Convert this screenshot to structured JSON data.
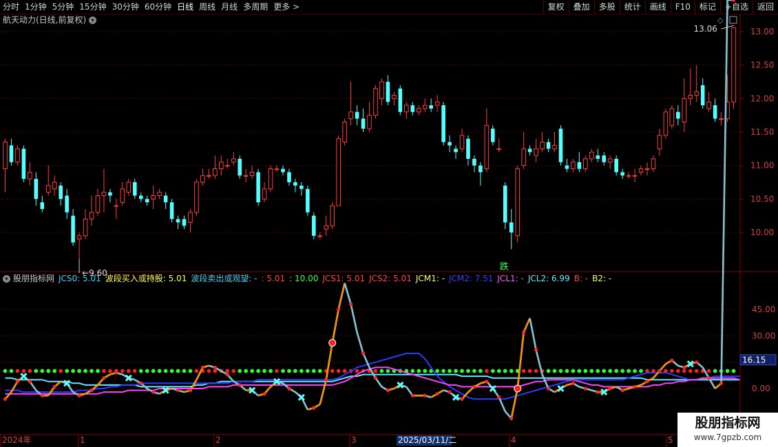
{
  "toolbar": {
    "periods": [
      "分时",
      "1分钟",
      "5分钟",
      "15分钟",
      "30分钟",
      "60分钟",
      "日线",
      "周线",
      "月线",
      "多周期",
      "更多 >"
    ],
    "active_period": "日线",
    "right_buttons": [
      "复权",
      "叠加",
      "多股",
      "统计",
      "画线",
      "F10",
      "标记",
      "+自选",
      "返回"
    ]
  },
  "main_chart": {
    "title": "航天动力(日线,前复权)",
    "price_labels": [
      "13.00",
      "12.50",
      "12.00",
      "11.50",
      "11.00",
      "10.50",
      "10.00"
    ],
    "high_marker": "13.06",
    "low_marker": "9.60",
    "signal_text": "跌"
  },
  "indicator": {
    "name": "股朋指标网",
    "header_items": [
      {
        "text": "JCS0: 5.01",
        "color": "#46d2f0"
      },
      {
        "text": "波段买入或持股: 5.01",
        "color": "#ffff55"
      },
      {
        "text": "波段卖出或观望: -",
        "color": "#46d2f0"
      },
      {
        "text": ": 5.01",
        "color": "#ff4040"
      },
      {
        "text": ": 10.00",
        "color": "#40ff40"
      },
      {
        "text": "JCS1: 5.01",
        "color": "#ff4040"
      },
      {
        "text": "JCS2: 5.01",
        "color": "#ff4040"
      },
      {
        "text": "JCM1: -",
        "color": "#ffff55"
      },
      {
        "text": "JCM2: 7.51",
        "color": "#3c3cff"
      },
      {
        "text": "JCL1: -",
        "color": "#ff55ff"
      },
      {
        "text": "JCL2: 6.99",
        "color": "#66e8ff"
      },
      {
        "text": "B: -",
        "color": "#ff4040"
      },
      {
        "text": "B2: -",
        "color": "#ffff55"
      }
    ],
    "axis_labels": [
      "45.00",
      "30.00",
      "15.00",
      "0.00"
    ],
    "current_value": "16.15"
  },
  "time_axis": {
    "labels": [
      "2024年",
      "1",
      "2",
      "3",
      "4",
      "5"
    ],
    "cursor_date": "2025/03/11/二"
  },
  "watermark": {
    "title": "股朋指标网",
    "url": "www.7gpzb.com"
  },
  "chart_data": {
    "type": "candlestick",
    "title": "航天动力(日线,前复权)",
    "ylim": [
      9.4,
      13.2
    ],
    "candles": [
      [
        10.95,
        11.35,
        10.6,
        11.4
      ],
      [
        11.3,
        11.05,
        11.0,
        11.4
      ],
      [
        11.05,
        11.25,
        11.0,
        11.3
      ],
      [
        11.25,
        10.8,
        10.75,
        11.3
      ],
      [
        10.8,
        10.9,
        10.7,
        11.05
      ],
      [
        10.8,
        10.5,
        10.4,
        10.9
      ],
      [
        10.45,
        10.35,
        10.3,
        10.55
      ],
      [
        10.6,
        10.7,
        10.55,
        11.0
      ],
      [
        10.65,
        10.75,
        10.55,
        10.85
      ],
      [
        10.7,
        10.5,
        10.4,
        10.75
      ],
      [
        10.55,
        10.3,
        10.2,
        10.65
      ],
      [
        10.25,
        9.85,
        9.8,
        10.35
      ],
      [
        9.9,
        9.95,
        9.6,
        10.0
      ],
      [
        9.95,
        10.2,
        9.9,
        10.35
      ],
      [
        10.2,
        10.3,
        10.1,
        10.55
      ],
      [
        10.3,
        10.55,
        10.25,
        10.65
      ],
      [
        10.55,
        10.6,
        10.3,
        10.95
      ],
      [
        10.6,
        10.55,
        10.45,
        10.65
      ],
      [
        10.4,
        10.4,
        10.2,
        10.5
      ],
      [
        10.45,
        10.65,
        10.4,
        10.75
      ],
      [
        10.6,
        10.75,
        10.55,
        10.8
      ],
      [
        10.75,
        10.55,
        10.5,
        10.8
      ],
      [
        10.55,
        10.5,
        10.45,
        10.6
      ],
      [
        10.5,
        10.45,
        10.4,
        10.55
      ],
      [
        10.5,
        10.55,
        10.35,
        10.7
      ],
      [
        10.55,
        10.6,
        10.5,
        10.65
      ],
      [
        10.55,
        10.45,
        10.35,
        10.6
      ],
      [
        10.45,
        10.2,
        10.15,
        10.5
      ],
      [
        10.2,
        10.15,
        10.05,
        10.25
      ],
      [
        10.2,
        10.1,
        10.05,
        10.25
      ],
      [
        10.15,
        10.3,
        10.0,
        10.35
      ],
      [
        10.3,
        10.75,
        10.25,
        10.8
      ],
      [
        10.75,
        10.85,
        10.7,
        10.95
      ],
      [
        10.85,
        10.85,
        10.8,
        10.95
      ],
      [
        10.85,
        10.95,
        10.8,
        11.15
      ],
      [
        10.95,
        11.05,
        10.85,
        11.15
      ],
      [
        11.0,
        11.0,
        10.95,
        11.1
      ],
      [
        11.05,
        11.1,
        11.0,
        11.2
      ],
      [
        11.1,
        10.85,
        10.8,
        11.15
      ],
      [
        10.85,
        10.85,
        10.75,
        10.95
      ],
      [
        10.85,
        10.9,
        10.8,
        11.0
      ],
      [
        10.9,
        10.45,
        10.4,
        10.95
      ],
      [
        10.5,
        10.65,
        10.45,
        10.75
      ],
      [
        10.65,
        10.95,
        10.6,
        11.0
      ],
      [
        10.95,
        10.95,
        10.9,
        11.0
      ],
      [
        10.95,
        10.9,
        10.85,
        11.0
      ],
      [
        10.9,
        10.75,
        10.7,
        10.95
      ],
      [
        10.75,
        10.7,
        10.6,
        10.8
      ],
      [
        10.7,
        10.65,
        10.55,
        10.75
      ],
      [
        10.65,
        10.3,
        10.25,
        10.7
      ],
      [
        10.25,
        9.95,
        9.9,
        10.3
      ],
      [
        9.95,
        9.95,
        9.9,
        10.0
      ],
      [
        10.05,
        10.1,
        9.95,
        10.25
      ],
      [
        10.1,
        10.4,
        10.05,
        10.45
      ],
      [
        10.4,
        11.4,
        10.4,
        11.45
      ],
      [
        11.35,
        11.65,
        11.3,
        11.7
      ],
      [
        11.7,
        11.8,
        11.6,
        12.25
      ],
      [
        11.8,
        11.7,
        11.6,
        11.9
      ],
      [
        11.7,
        11.55,
        11.5,
        11.85
      ],
      [
        11.55,
        11.75,
        11.5,
        11.95
      ],
      [
        11.75,
        12.15,
        11.7,
        12.2
      ],
      [
        12.0,
        12.25,
        11.9,
        12.3
      ],
      [
        12.25,
        11.95,
        11.9,
        12.35
      ],
      [
        12.0,
        12.05,
        11.9,
        12.1
      ],
      [
        12.15,
        11.8,
        11.75,
        12.2
      ],
      [
        11.8,
        11.9,
        11.7,
        11.95
      ],
      [
        11.9,
        11.8,
        11.75,
        11.95
      ],
      [
        11.8,
        11.85,
        11.75,
        11.9
      ],
      [
        11.85,
        11.9,
        11.8,
        12.0
      ],
      [
        11.9,
        11.85,
        11.8,
        12.0
      ],
      [
        11.9,
        11.95,
        11.8,
        12.05
      ],
      [
        11.9,
        11.35,
        11.3,
        11.95
      ],
      [
        11.35,
        11.3,
        11.2,
        11.45
      ],
      [
        11.25,
        11.2,
        11.1,
        11.3
      ],
      [
        11.25,
        11.45,
        11.2,
        11.55
      ],
      [
        11.4,
        11.1,
        11.0,
        11.45
      ],
      [
        11.1,
        11.0,
        10.9,
        11.15
      ],
      [
        11.0,
        10.9,
        10.7,
        11.05
      ],
      [
        10.95,
        11.6,
        10.9,
        11.85
      ],
      [
        11.55,
        11.35,
        11.3,
        11.6
      ],
      [
        11.25,
        11.25,
        11.2,
        11.4
      ],
      [
        10.7,
        10.15,
        10.05,
        10.75
      ],
      [
        10.15,
        10.0,
        9.75,
        10.35
      ],
      [
        9.95,
        10.95,
        9.85,
        11.0
      ],
      [
        11.0,
        11.25,
        10.95,
        11.5
      ],
      [
        11.25,
        11.2,
        11.15,
        11.3
      ],
      [
        11.15,
        11.25,
        11.05,
        11.4
      ],
      [
        11.25,
        11.35,
        11.2,
        11.5
      ],
      [
        11.35,
        11.25,
        11.2,
        11.4
      ],
      [
        11.25,
        11.3,
        11.2,
        11.5
      ],
      [
        11.55,
        11.05,
        11.0,
        11.6
      ],
      [
        11.0,
        10.95,
        10.9,
        11.1
      ],
      [
        10.95,
        11.05,
        10.9,
        11.1
      ],
      [
        11.05,
        10.95,
        10.9,
        11.2
      ],
      [
        10.95,
        11.1,
        10.9,
        11.15
      ],
      [
        11.1,
        11.2,
        11.05,
        11.25
      ],
      [
        11.15,
        11.1,
        11.05,
        11.25
      ],
      [
        11.15,
        11.05,
        11.0,
        11.2
      ],
      [
        11.05,
        11.1,
        10.95,
        11.15
      ],
      [
        11.1,
        10.9,
        10.85,
        11.15
      ],
      [
        10.9,
        10.85,
        10.8,
        10.95
      ],
      [
        10.85,
        10.85,
        10.8,
        10.9
      ],
      [
        10.85,
        10.85,
        10.75,
        10.95
      ],
      [
        10.9,
        10.95,
        10.85,
        11.0
      ],
      [
        10.95,
        10.95,
        10.85,
        11.05
      ],
      [
        10.95,
        11.1,
        10.9,
        11.15
      ],
      [
        11.25,
        11.45,
        11.15,
        11.55
      ],
      [
        11.45,
        11.8,
        11.4,
        11.85
      ],
      [
        11.6,
        11.85,
        11.55,
        11.9
      ],
      [
        11.8,
        11.7,
        11.6,
        11.9
      ],
      [
        11.65,
        12.0,
        11.5,
        12.3
      ],
      [
        12.0,
        12.05,
        11.9,
        12.45
      ],
      [
        12.05,
        12.1,
        11.95,
        12.5
      ],
      [
        12.2,
        11.9,
        11.85,
        12.3
      ],
      [
        11.85,
        11.95,
        11.8,
        12.1
      ],
      [
        11.9,
        11.7,
        11.65,
        12.0
      ],
      [
        11.7,
        11.7,
        11.6,
        11.8
      ],
      [
        11.7,
        11.95,
        11.65,
        12.35
      ],
      [
        11.95,
        13.06,
        11.85,
        13.06
      ]
    ],
    "indicator_ylim": [
      -18,
      60
    ],
    "indicator_series": [
      {
        "name": "JCS0",
        "values": [
          -6,
          -2,
          4,
          7,
          4,
          -1,
          -4,
          -4,
          1,
          4,
          3,
          -2,
          -4,
          -3,
          -1,
          2,
          6,
          8,
          9,
          8,
          6,
          5,
          3,
          0,
          -2,
          -3,
          -1,
          0,
          -1,
          -2,
          -1,
          5,
          12,
          13,
          12,
          10,
          8,
          4,
          2,
          -1,
          -1,
          -4,
          -3,
          1,
          4,
          3,
          0,
          -2,
          -5,
          -12,
          -11,
          -9,
          5,
          26,
          45,
          60,
          48,
          32,
          20,
          12,
          6,
          1,
          -1,
          0,
          2,
          1,
          -4,
          -4,
          -4,
          -5,
          -3,
          -1,
          -2,
          -5,
          -6,
          -2,
          1,
          3,
          4,
          0,
          -5,
          -13,
          -17,
          0,
          32,
          40,
          22,
          8,
          0,
          -2,
          0,
          2,
          3,
          1,
          0,
          -1,
          -2,
          -2,
          0,
          1,
          -1,
          0,
          1,
          2,
          4,
          6,
          10,
          14,
          16,
          13,
          12,
          14,
          15,
          12,
          6,
          0,
          3
        ]
      },
      {
        "name": "JCL2",
        "values": [
          6,
          6,
          5,
          5,
          5,
          5,
          5,
          4,
          4,
          4,
          4,
          3,
          3,
          2,
          2,
          2,
          2,
          2,
          2,
          2,
          2,
          2,
          1,
          1,
          1,
          1,
          1,
          1,
          1,
          1,
          1,
          2,
          2,
          3,
          3,
          4,
          4,
          4,
          4,
          4,
          4,
          4,
          4,
          4,
          4,
          4,
          4,
          4,
          4,
          4,
          4,
          4,
          4,
          4,
          5,
          6,
          7,
          7,
          8,
          8,
          8,
          8,
          8,
          8,
          8,
          8,
          8,
          8,
          8,
          8,
          8,
          8,
          8,
          8,
          7,
          7,
          7,
          7,
          7,
          6,
          6,
          6,
          6,
          6,
          6,
          6,
          6,
          6,
          6,
          6,
          6,
          6,
          6,
          6,
          6,
          6,
          6,
          6,
          6,
          6,
          6,
          6,
          6,
          6,
          5,
          5,
          5,
          5,
          5,
          5,
          5,
          5,
          5,
          5,
          5,
          5,
          5,
          5,
          5,
          5
        ]
      },
      {
        "name": "JCM2",
        "values": [
          -1,
          -1,
          -1,
          -2,
          -2,
          -2,
          -2,
          -2,
          -2,
          -2,
          -2,
          -2,
          -1,
          -1,
          -1,
          0,
          0,
          1,
          1,
          2,
          2,
          2,
          3,
          3,
          3,
          3,
          3,
          3,
          3,
          3,
          3,
          3,
          3,
          3,
          3,
          3,
          3,
          4,
          4,
          4,
          4,
          5,
          5,
          5,
          5,
          5,
          5,
          5,
          5,
          5,
          5,
          5,
          5,
          5,
          6,
          8,
          10,
          12,
          13,
          14,
          15,
          16,
          17,
          18,
          19,
          20,
          20,
          20,
          17,
          12,
          7,
          4,
          1,
          -1,
          -3,
          -5,
          -6,
          -6,
          -6,
          -6,
          -6,
          -6,
          -5,
          -4,
          -3,
          -2,
          -1,
          0,
          1,
          2,
          3,
          4,
          5,
          5,
          5,
          5,
          5,
          5,
          5,
          5,
          5,
          6,
          7,
          8,
          9,
          9,
          9,
          9,
          8,
          7,
          6,
          5,
          5,
          6,
          6,
          7,
          7,
          7,
          7,
          7
        ]
      },
      {
        "name": "JCL1",
        "values": [
          -3,
          -3,
          -3,
          -3,
          -3,
          -3,
          -3,
          -3,
          -3,
          -3,
          -3,
          -3,
          -3,
          -3,
          -3,
          -3,
          -2,
          -2,
          -2,
          -2,
          -1,
          -1,
          -1,
          -1,
          -1,
          0,
          0,
          0,
          0,
          0,
          0,
          0,
          0,
          1,
          1,
          1,
          1,
          2,
          2,
          2,
          2,
          2,
          2,
          2,
          2,
          2,
          2,
          2,
          2,
          2,
          2,
          2,
          2,
          2,
          3,
          4,
          6,
          8,
          10,
          11,
          12,
          12,
          12,
          11,
          10,
          9,
          8,
          7,
          6,
          5,
          4,
          3,
          2,
          2,
          1,
          1,
          1,
          1,
          1,
          1,
          1,
          1,
          1,
          1,
          2,
          3,
          4,
          4,
          5,
          5,
          5,
          5,
          5,
          4,
          3,
          2,
          2,
          1,
          1,
          1,
          1,
          1,
          1,
          1,
          1,
          2,
          2,
          3,
          3,
          4,
          4,
          5,
          5,
          6,
          6,
          6,
          6,
          6,
          6,
          5
        ]
      }
    ]
  }
}
